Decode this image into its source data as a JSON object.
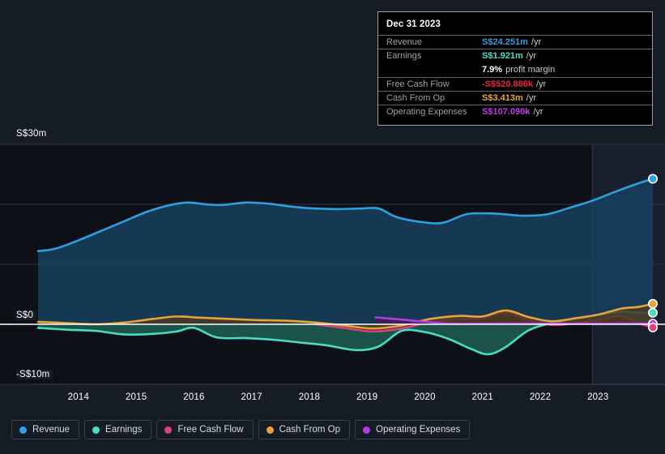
{
  "theme": {
    "background": "#151c26",
    "plot_background": "#0d1117",
    "forecast_background": "#121b27",
    "zero_line_color": "#ffffff",
    "grid_color": "#2d3846"
  },
  "tooltip": {
    "title": "Dec 31 2023",
    "rows": [
      {
        "key": "Revenue",
        "value": "S$24.251m",
        "unit": "/yr",
        "color": "#2e9fe0"
      },
      {
        "key": "Earnings",
        "value": "S$1.921m",
        "unit": "/yr",
        "color": "#4bdbc3"
      },
      {
        "key": "",
        "value": "7.9%",
        "unit": "profit margin",
        "color": "#ffffff"
      },
      {
        "key": "Free Cash Flow",
        "value": "-S$520.886k",
        "unit": "/yr",
        "color": "#e8273d"
      },
      {
        "key": "Cash From Op",
        "value": "S$3.413m",
        "unit": "/yr",
        "color": "#e8a33d"
      },
      {
        "key": "Operating Expenses",
        "value": "S$107.090k",
        "unit": "/yr",
        "color": "#c13ae8"
      }
    ]
  },
  "legend": {
    "items": [
      {
        "label": "Revenue",
        "color": "#2e9fe0"
      },
      {
        "label": "Earnings",
        "color": "#4bdbc3"
      },
      {
        "label": "Free Cash Flow",
        "color": "#d6447c"
      },
      {
        "label": "Cash From Op",
        "color": "#e8a33d"
      },
      {
        "label": "Operating Expenses",
        "color": "#b43ce8"
      }
    ]
  },
  "axis": {
    "y_labels": [
      "S$30m",
      "S$0",
      "-S$10m"
    ],
    "x_labels": [
      "2014",
      "2015",
      "2016",
      "2017",
      "2018",
      "2019",
      "2020",
      "2021",
      "2022",
      "2023"
    ]
  },
  "chart_data": {
    "type": "area",
    "title": "",
    "subtitle": "",
    "xlabel": "",
    "ylabel": "S$",
    "currency": "SGD",
    "units": "millions",
    "grid": true,
    "legend_position": "bottom-left",
    "ylim": [
      -10,
      30
    ],
    "y_ticks": [
      30,
      20,
      10,
      0,
      -10
    ],
    "y_tick_labels": [
      "S$30m",
      "",
      "",
      "S$0",
      "-S$10m"
    ],
    "xlim": [
      2013.3,
      2023.95
    ],
    "x_ticks": [
      2014,
      2015,
      2016,
      2017,
      2018,
      2019,
      2020,
      2021,
      2022,
      2023
    ],
    "zero_line": 0,
    "forecast_start": 2022.9,
    "series": [
      {
        "name": "Revenue",
        "color": "#2e9fe0",
        "fill": "#17405e",
        "x": [
          2013.3,
          2013.6,
          2014.0,
          2014.4,
          2014.8,
          2015.2,
          2015.6,
          2015.9,
          2016.2,
          2016.5,
          2016.9,
          2017.3,
          2017.7,
          2018.1,
          2018.5,
          2018.9,
          2019.2,
          2019.5,
          2019.9,
          2020.3,
          2020.7,
          2021.0,
          2021.3,
          2021.7,
          2022.1,
          2022.5,
          2022.9,
          2023.3,
          2023.7,
          2023.95
        ],
        "y": [
          12.2,
          12.6,
          14.0,
          15.6,
          17.2,
          18.8,
          19.9,
          20.3,
          20.0,
          19.9,
          20.3,
          20.1,
          19.6,
          19.3,
          19.2,
          19.3,
          19.3,
          17.9,
          17.1,
          16.9,
          18.3,
          18.5,
          18.4,
          18.1,
          18.3,
          19.4,
          20.6,
          22.1,
          23.5,
          24.251
        ]
      },
      {
        "name": "Earnings",
        "color": "#4bdbc3",
        "fill": "#1f5f55",
        "x": [
          2013.3,
          2013.8,
          2014.3,
          2014.8,
          2015.3,
          2015.7,
          2016.0,
          2016.4,
          2016.9,
          2017.4,
          2017.9,
          2018.3,
          2018.8,
          2019.2,
          2019.6,
          2020.0,
          2020.4,
          2020.8,
          2021.1,
          2021.4,
          2021.8,
          2022.2,
          2022.6,
          2023.0,
          2023.4,
          2023.7,
          2023.95
        ],
        "y": [
          -0.6,
          -0.9,
          -1.1,
          -1.7,
          -1.6,
          -1.2,
          -0.6,
          -2.2,
          -2.3,
          -2.6,
          -3.1,
          -3.5,
          -4.3,
          -3.7,
          -1.1,
          -1.3,
          -2.4,
          -4.1,
          -5.0,
          -3.8,
          -1.0,
          0.2,
          0.9,
          1.5,
          2.1,
          1.9,
          1.921
        ]
      },
      {
        "name": "Free Cash Flow",
        "color": "#d6447c",
        "fill": "#5c1f2c",
        "x": [
          2018.1,
          2018.6,
          2019.1,
          2019.6,
          2020.1,
          2020.6,
          2021.0,
          2021.4,
          2021.8,
          2022.2,
          2022.6,
          2023.0,
          2023.4,
          2023.7,
          2023.95
        ],
        "y": [
          0.0,
          -0.6,
          -1.2,
          -0.7,
          0.4,
          0.9,
          1.0,
          1.9,
          0.7,
          -0.1,
          0.2,
          0.7,
          1.4,
          0.2,
          -0.521
        ]
      },
      {
        "name": "Cash From Op",
        "color": "#e8a33d",
        "fill": "#4a3a22",
        "x": [
          2013.3,
          2013.8,
          2014.3,
          2014.8,
          2015.3,
          2015.7,
          2016.1,
          2016.6,
          2017.1,
          2017.6,
          2018.1,
          2018.6,
          2019.1,
          2019.6,
          2020.1,
          2020.6,
          2021.0,
          2021.4,
          2021.8,
          2022.2,
          2022.6,
          2023.0,
          2023.4,
          2023.7,
          2023.95
        ],
        "y": [
          0.4,
          0.2,
          0.0,
          0.3,
          0.9,
          1.3,
          1.1,
          0.9,
          0.7,
          0.6,
          0.3,
          -0.2,
          -0.7,
          -0.2,
          0.9,
          1.4,
          1.3,
          2.3,
          1.2,
          0.5,
          1.0,
          1.6,
          2.6,
          2.9,
          3.413
        ]
      },
      {
        "name": "Operating Expenses",
        "color": "#b43ce8",
        "fill": "#3d1f5c",
        "x": [
          2019.15,
          2019.6,
          2020.0,
          2020.4,
          2020.9,
          2021.5,
          2022.2,
          2023.0,
          2023.95
        ],
        "y": [
          1.15,
          0.78,
          0.42,
          0.12,
          0.11,
          0.11,
          0.11,
          0.11,
          0.107
        ]
      }
    ],
    "end_markers": [
      {
        "name": "Revenue",
        "color": "#2e9fe0",
        "value": 24.251
      },
      {
        "name": "Cash From Op",
        "color": "#e8a33d",
        "value": 3.413
      },
      {
        "name": "Earnings",
        "color": "#4bdbc3",
        "value": 1.921
      },
      {
        "name": "Operating Expenses",
        "color": "#b43ce8",
        "value": 0.107
      },
      {
        "name": "Free Cash Flow",
        "color": "#d6447c",
        "value": -0.521
      }
    ]
  }
}
